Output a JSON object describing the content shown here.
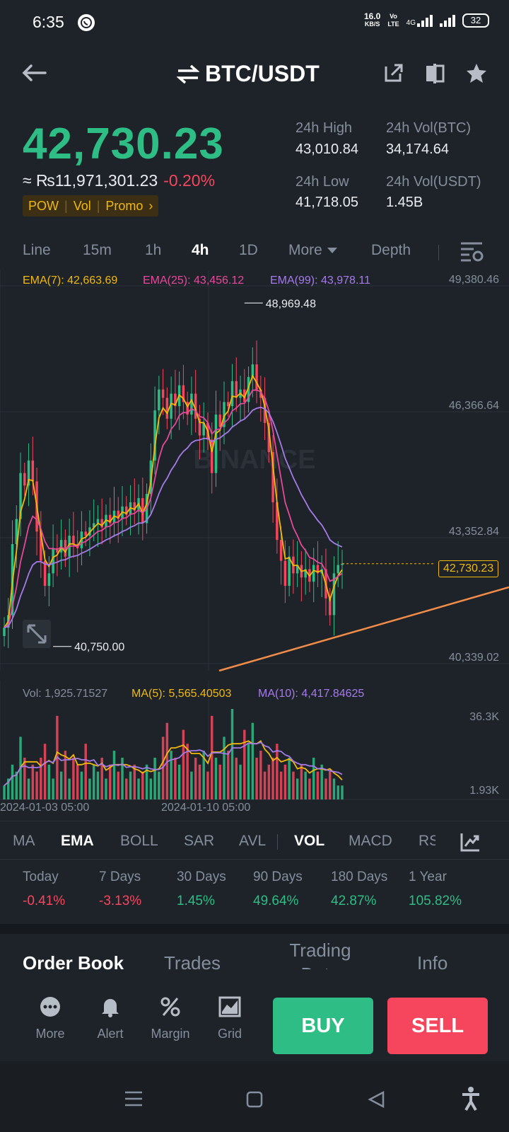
{
  "status": {
    "time": "6:35",
    "speed_value": "16.0",
    "speed_unit": "KB/S",
    "volte_top": "Vo",
    "volte_bottom": "LTE",
    "net": "4G",
    "battery": "32"
  },
  "header": {
    "pair": "BTC/USDT"
  },
  "ticker": {
    "last_price": "42,730.23",
    "fiat": "≈ ₨11,971,301.23",
    "change": "-0.20%",
    "tags": [
      "POW",
      "Vol",
      "Promo"
    ],
    "high_label": "24h High",
    "high": "43,010.84",
    "low_label": "24h Low",
    "low": "41,718.05",
    "vol_btc_label": "24h Vol(BTC)",
    "vol_btc": "34,174.64",
    "vol_usdt_label": "24h Vol(USDT)",
    "vol_usdt": "1.45B"
  },
  "timeframes": {
    "items": [
      "Line",
      "15m",
      "1h",
      "4h",
      "1D",
      "More",
      "Depth"
    ],
    "active": "4h"
  },
  "chart_data": {
    "type": "candlestick",
    "title": "",
    "watermark": "BINANCE",
    "y_ticks": [
      "49,380.46",
      "46,366.64",
      "43,352.84",
      "40,339.02"
    ],
    "ylim": [
      40339.02,
      49380.46
    ],
    "x_ticks": [
      "2024-01-03 05:00",
      "2024-01-10 05:00"
    ],
    "indicators": [
      {
        "name": "EMA(7)",
        "value": "42,663.69",
        "color": "#f0b90b"
      },
      {
        "name": "EMA(25)",
        "value": "43,456.12",
        "color": "#e6499b"
      },
      {
        "name": "EMA(99)",
        "value": "43,978.11",
        "color": "#a57be8"
      }
    ],
    "high_marker": "48,969.48",
    "low_marker": "40,750.00",
    "last_price_label": "42,730.23",
    "close_series": [
      41200,
      41500,
      43200,
      43800,
      44900,
      44600,
      45200,
      44700,
      43500,
      42800,
      42200,
      42500,
      43100,
      43000,
      43300,
      42900,
      43400,
      43200,
      43100,
      43500,
      43400,
      43600,
      43700,
      43800,
      43600,
      43900,
      43700,
      44000,
      43800,
      44100,
      43900,
      44200,
      44000,
      44300,
      43700,
      44400,
      45200,
      46400,
      46900,
      46700,
      46200,
      46800,
      46500,
      47000,
      46600,
      46300,
      46800,
      46200,
      45800,
      46100,
      45700,
      44900,
      46300,
      46000,
      46600,
      46500,
      47100,
      46700,
      46900,
      46600,
      47200,
      47500,
      46900,
      46700,
      46100,
      45400,
      44200,
      43300,
      42800,
      42200,
      42900,
      42500,
      42700,
      42400,
      42600,
      42300,
      42700,
      42500,
      42600,
      41900,
      41500,
      42500,
      42700,
      42730
    ]
  },
  "volume": {
    "vol_label": "Vol: 1,925.71527",
    "ma5_label": "MA(5): 5,565.40503",
    "ma10_label": "MA(10): 4,417.84625",
    "y_ticks": [
      "36.3K",
      "1.93K"
    ],
    "values": [
      2,
      3,
      5,
      4,
      9,
      6,
      3,
      5,
      4,
      6,
      8,
      5,
      3,
      12,
      4,
      7,
      3,
      6,
      5,
      4,
      8,
      3,
      5,
      4,
      6,
      3,
      5,
      7,
      4,
      6,
      3,
      4,
      5,
      3,
      4,
      5,
      3,
      6,
      4,
      9,
      11,
      7,
      6,
      5,
      10,
      8,
      4,
      6,
      5,
      7,
      4,
      12,
      6,
      5,
      9,
      7,
      13,
      6,
      5,
      10,
      8,
      11,
      6,
      7,
      4,
      5,
      6,
      8,
      4,
      5,
      6,
      4,
      3,
      5,
      4,
      3,
      6,
      4,
      5,
      3,
      4,
      3,
      2,
      2
    ]
  },
  "indicator_tabs": {
    "items": [
      "MA",
      "EMA",
      "BOLL",
      "SAR",
      "AVL",
      "VOL",
      "MACD",
      "RS"
    ],
    "active": [
      "EMA",
      "VOL"
    ]
  },
  "performance": [
    {
      "label": "Today",
      "value": "-0.41%"
    },
    {
      "label": "7 Days",
      "value": "-3.13%"
    },
    {
      "label": "30 Days",
      "value": "1.45%"
    },
    {
      "label": "90 Days",
      "value": "49.64%"
    },
    {
      "label": "180 Days",
      "value": "42.87%"
    },
    {
      "label": "1 Year",
      "value": "105.82%"
    }
  ],
  "bottom_tabs": {
    "items": [
      "Order Book",
      "Trades",
      "Trading Data",
      "Info"
    ],
    "active": "Order Book"
  },
  "actions": {
    "more": "More",
    "alert": "Alert",
    "margin": "Margin",
    "grid": "Grid",
    "buy": "BUY",
    "sell": "SELL"
  },
  "colors": {
    "up": "#2ebd85",
    "down": "#f6465d",
    "accent": "#f0b90b",
    "bg": "#1e2329"
  }
}
